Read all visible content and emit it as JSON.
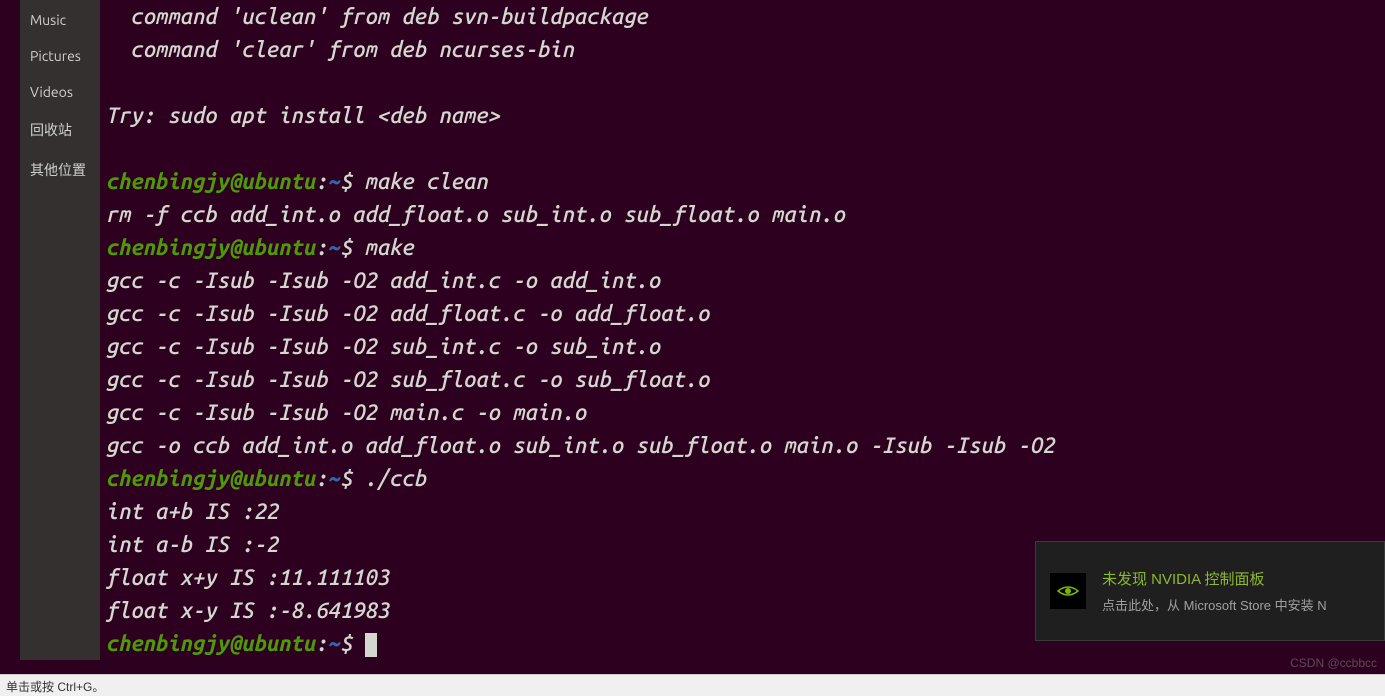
{
  "sidebar": {
    "items": [
      {
        "label": "Music"
      },
      {
        "label": "Pictures"
      },
      {
        "label": "Videos"
      },
      {
        "label": "回收站"
      },
      {
        "label": "其他位置"
      }
    ]
  },
  "terminal": {
    "lines": [
      {
        "type": "output",
        "text": "  command 'uclean' from deb svn-buildpackage"
      },
      {
        "type": "output",
        "text": "  command 'clear' from deb ncurses-bin"
      },
      {
        "type": "blank",
        "text": ""
      },
      {
        "type": "output",
        "text": "Try: sudo apt install <deb name>"
      },
      {
        "type": "blank",
        "text": ""
      },
      {
        "type": "prompt",
        "user": "chenbingjy@ubuntu",
        "path": "~",
        "cmd": "make clean"
      },
      {
        "type": "output",
        "text": "rm -f ccb add_int.o add_float.o sub_int.o sub_float.o main.o"
      },
      {
        "type": "prompt",
        "user": "chenbingjy@ubuntu",
        "path": "~",
        "cmd": "make"
      },
      {
        "type": "output",
        "text": "gcc -c -Isub -Isub -O2 add_int.c -o add_int.o"
      },
      {
        "type": "output",
        "text": "gcc -c -Isub -Isub -O2 add_float.c -o add_float.o"
      },
      {
        "type": "output",
        "text": "gcc -c -Isub -Isub -O2 sub_int.c -o sub_int.o"
      },
      {
        "type": "output",
        "text": "gcc -c -Isub -Isub -O2 sub_float.c -o sub_float.o"
      },
      {
        "type": "output",
        "text": "gcc -c -Isub -Isub -O2 main.c -o main.o"
      },
      {
        "type": "output",
        "text": "gcc -o ccb add_int.o add_float.o sub_int.o sub_float.o main.o -Isub -Isub -O2"
      },
      {
        "type": "prompt",
        "user": "chenbingjy@ubuntu",
        "path": "~",
        "cmd": "./ccb"
      },
      {
        "type": "output",
        "text": "int a+b IS :22"
      },
      {
        "type": "output",
        "text": "int a-b IS :-2"
      },
      {
        "type": "output",
        "text": "float x+y IS :11.111103"
      },
      {
        "type": "output",
        "text": "float x-y IS :-8.641983"
      },
      {
        "type": "prompt",
        "user": "chenbingjy@ubuntu",
        "path": "~",
        "cmd": "",
        "cursor": true
      }
    ],
    "prompt_sep": ":",
    "prompt_suffix": "$ "
  },
  "notification": {
    "title": "未发现 NVIDIA 控制面板",
    "body": "点击此处，从 Microsoft Store 中安装 N"
  },
  "statusbar": {
    "text": "单击或按 Ctrl+G。"
  },
  "watermark": "CSDN @ccbbcc"
}
